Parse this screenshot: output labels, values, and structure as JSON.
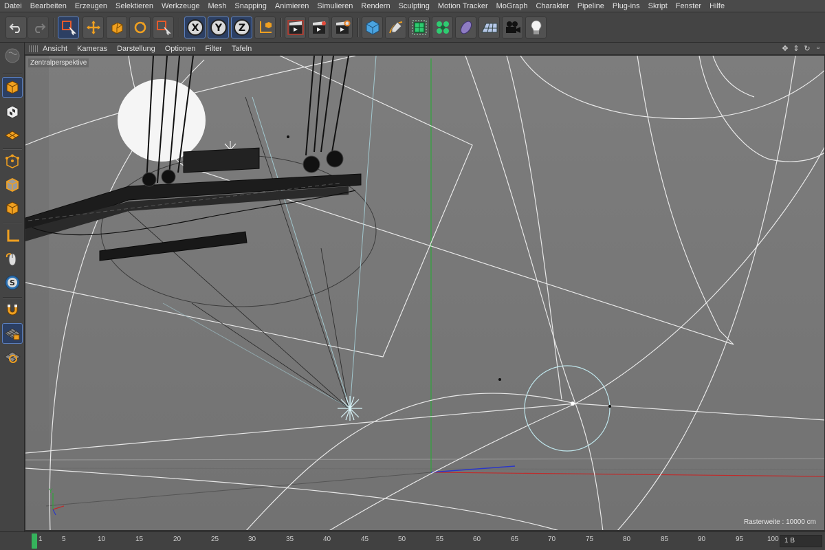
{
  "menu": {
    "items": [
      "Datei",
      "Bearbeiten",
      "Erzeugen",
      "Selektieren",
      "Werkzeuge",
      "Mesh",
      "Snapping",
      "Animieren",
      "Simulieren",
      "Rendern",
      "Sculpting",
      "Motion Tracker",
      "MoGraph",
      "Charakter",
      "Pipeline",
      "Plug-ins",
      "Skript",
      "Fenster",
      "Hilfe"
    ]
  },
  "toolbar": {
    "axis_x": "X",
    "axis_y": "Y",
    "axis_z": "Z"
  },
  "viewport_menu": {
    "items": [
      "Ansicht",
      "Kameras",
      "Darstellung",
      "Optionen",
      "Filter",
      "Tafeln"
    ]
  },
  "viewport": {
    "projection_label": "Zentralperspektive",
    "raster_label": "Rasterweite : 10000 cm",
    "axis_y_label": "Y"
  },
  "timeline": {
    "current_frame": "1",
    "ticks": [
      "5",
      "10",
      "15",
      "20",
      "25",
      "30",
      "35",
      "40",
      "45",
      "50",
      "55",
      "60",
      "65",
      "70",
      "75",
      "80",
      "85",
      "90",
      "95",
      "100"
    ],
    "frame_field": "1 B"
  },
  "colors": {
    "accent_blue": "#2c3f63",
    "playhead_green": "#35b35c",
    "axis_red": "#c02a2a",
    "axis_green": "#2fa63b",
    "axis_blue": "#2a36c9"
  }
}
